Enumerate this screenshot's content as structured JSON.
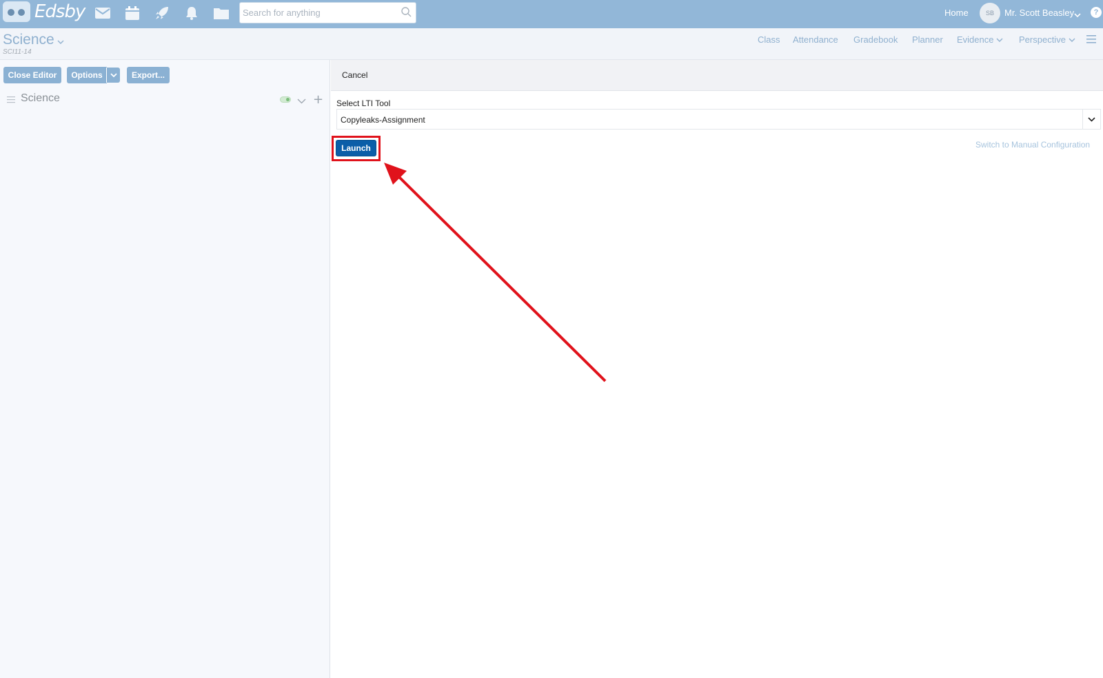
{
  "topbar": {
    "logo_text": "Edsby",
    "icons": [
      "mail-icon",
      "calendar-icon",
      "rocket-icon",
      "bell-icon",
      "folder-icon"
    ],
    "search_placeholder": "Search for anything",
    "home_label": "Home",
    "avatar_initials": "SB",
    "user_name": "Mr. Scott Beasley",
    "help_glyph": "?"
  },
  "subheader": {
    "class_title": "Science",
    "class_code": "SCI11-14",
    "nav": {
      "class": "Class",
      "attendance": "Attendance",
      "gradebook": "Gradebook",
      "planner": "Planner",
      "evidence": "Evidence",
      "perspective": "Perspective"
    }
  },
  "left": {
    "close_editor": "Close Editor",
    "options": "Options",
    "export": "Export...",
    "tree_item": "Science",
    "tree_plus": "+"
  },
  "right": {
    "cancel": "Cancel",
    "lti_label": "Select LTI Tool",
    "lti_value": "Copyleaks-Assignment",
    "launch": "Launch",
    "manual_link": "Switch to Manual Configuration"
  },
  "colors": {
    "topbar": "#92b7d8",
    "accent_button": "#8bb1d3",
    "launch_button": "#0b5ea8",
    "annotation_red": "#e0121b"
  }
}
